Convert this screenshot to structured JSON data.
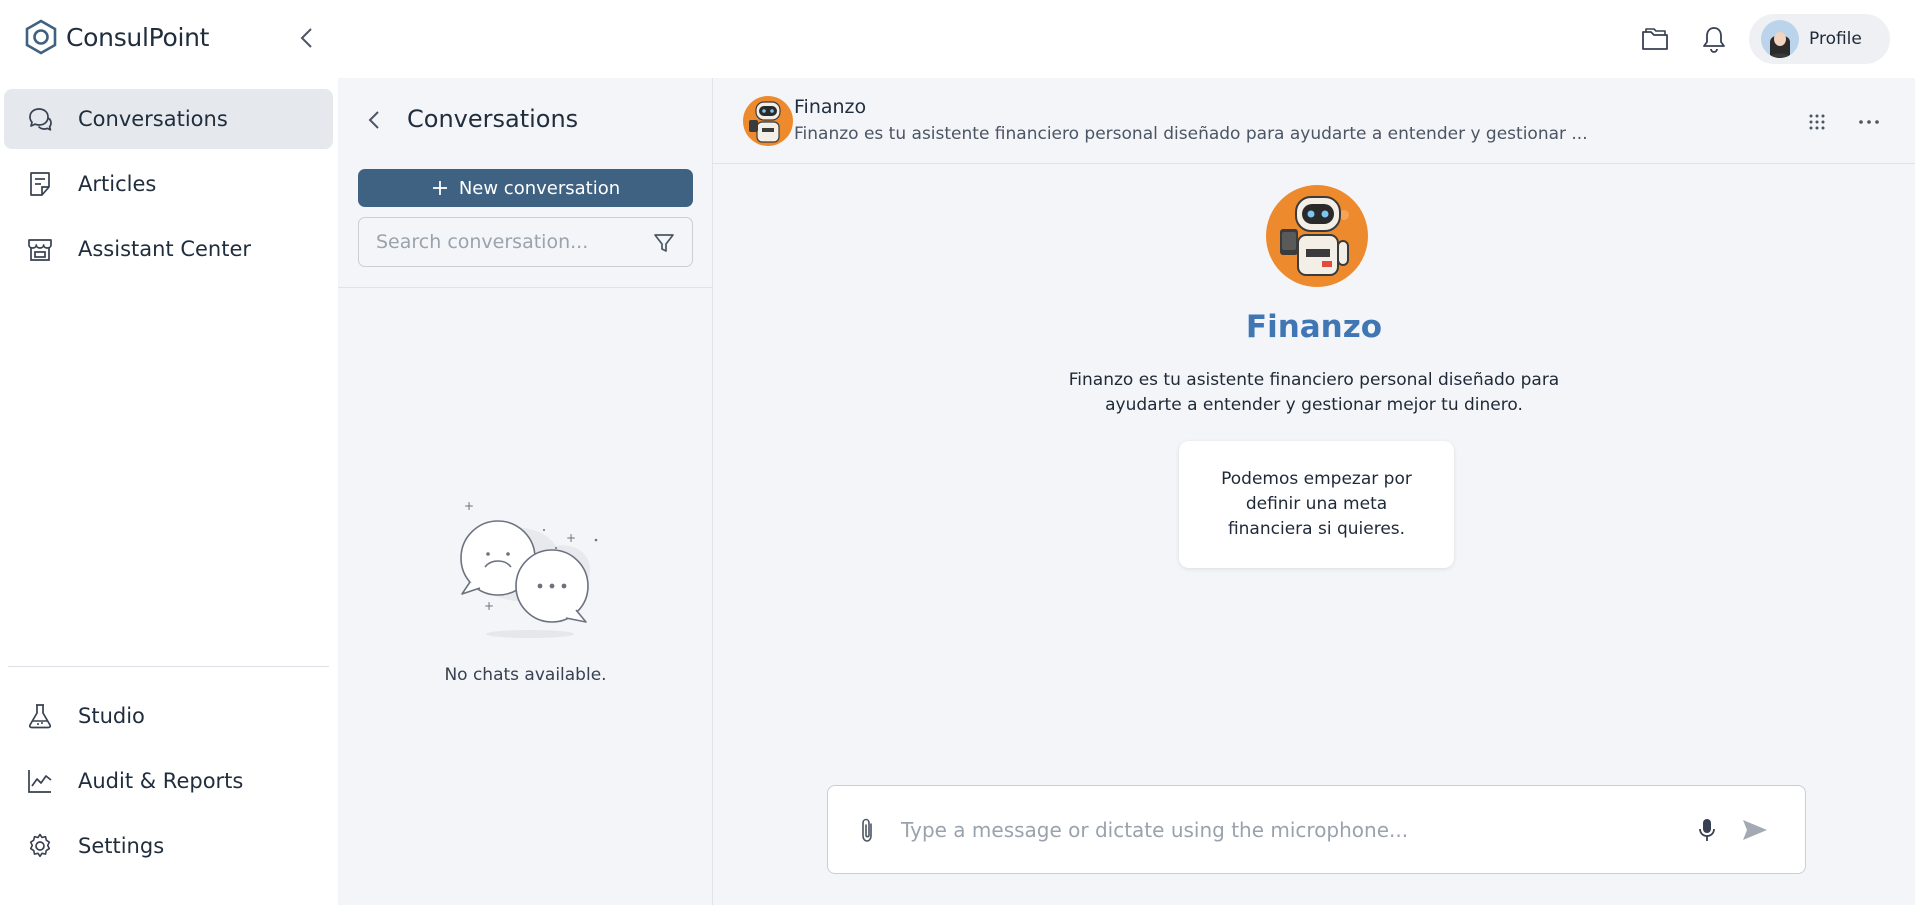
{
  "app": {
    "name": "ConsulPoint"
  },
  "topbar": {
    "icons": [
      "folder-icon",
      "bell-icon"
    ],
    "profile_label": "Profile"
  },
  "sidebar": {
    "items": [
      {
        "label": "Conversations",
        "icon": "chat-bubbles-icon",
        "active": true
      },
      {
        "label": "Articles",
        "icon": "document-icon",
        "active": false
      },
      {
        "label": "Assistant Center",
        "icon": "storefront-icon",
        "active": false
      }
    ],
    "bottom_items": [
      {
        "label": "Studio",
        "icon": "flask-icon"
      },
      {
        "label": "Audit & Reports",
        "icon": "line-chart-icon"
      },
      {
        "label": "Settings",
        "icon": "gear-icon"
      }
    ]
  },
  "conversations_panel": {
    "title": "Conversations",
    "new_button": "New conversation",
    "search_placeholder": "Search conversation...",
    "empty_text": "No chats available."
  },
  "chat": {
    "header": {
      "name": "Finanzo",
      "description": "Finanzo es tu asistente financiero personal diseñado para ayudarte a entender y gestionar ..."
    },
    "assistant": {
      "name": "Finanzo",
      "description": "Finanzo es tu asistente financiero personal diseñado para ayudarte a entender y gestionar mejor tu dinero."
    },
    "suggestion": "Podemos empezar por definir una meta financiera si quieres.",
    "composer_placeholder": "Type a message or dictate using the microphone..."
  },
  "colors": {
    "primary_button": "#3f6182",
    "assistant_name": "#3f76b3",
    "avatar_orange": "#ee8a2e",
    "panel_bg": "#f3f5f8",
    "active_nav": "#e5e8ec"
  }
}
